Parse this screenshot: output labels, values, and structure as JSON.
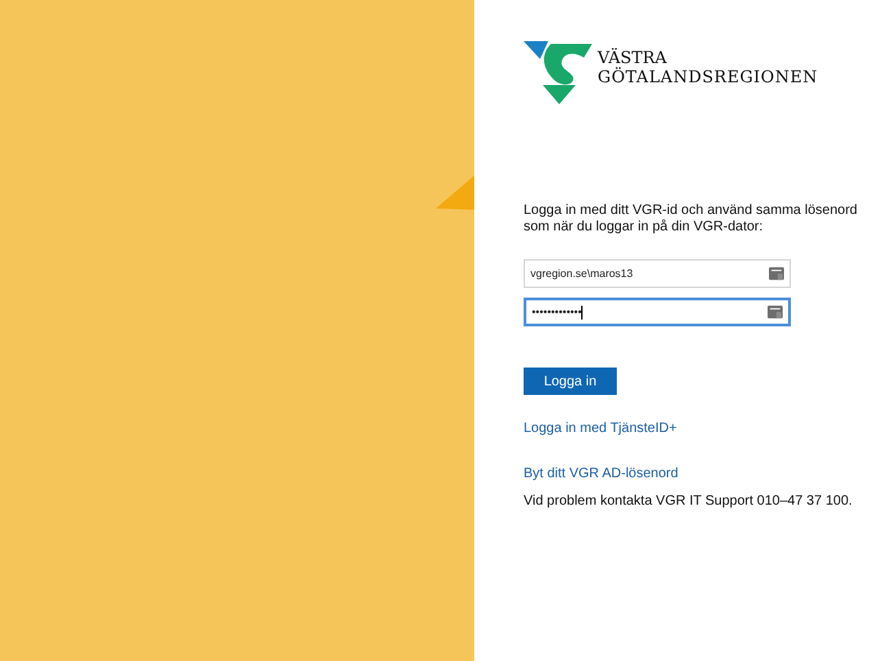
{
  "logo": {
    "line_1": "VÄSTRA",
    "line_2": "GÖTALANDSREGIONEN"
  },
  "intro": "Logga in med ditt VGR-id och använd samma lösenord som när du loggar in på din VGR-dator:",
  "fields": [
    {
      "value": "vgregion.se\\maros13",
      "focused": false
    },
    {
      "value": "•••••••••••••",
      "focused": true
    }
  ],
  "submit": "Logga in",
  "links": [
    "Logga in med TjänsteID+",
    "Byt ditt VGR AD-lösenord"
  ],
  "support": "Vid problem kontakta VGR IT Support 010–47 37 100."
}
